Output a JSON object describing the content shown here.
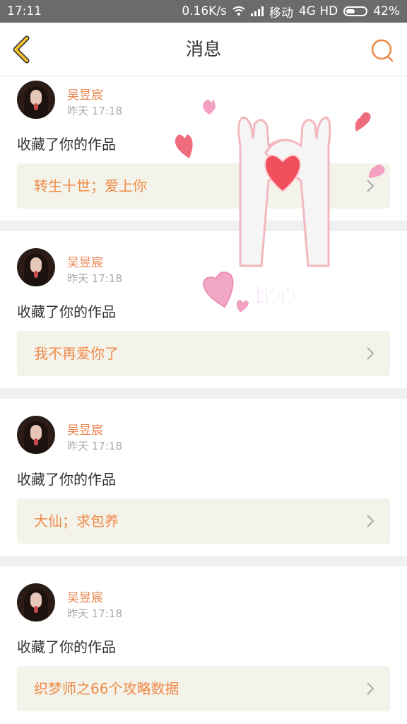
{
  "status_bar": {
    "time": "17:11",
    "speed": "0.16K/s",
    "carrier": "移动",
    "network": "4G HD",
    "battery": "42%"
  },
  "header": {
    "title": "消息",
    "back_icon": "chevron-left-icon",
    "search_icon": "search-icon"
  },
  "messages": [
    {
      "user": "吴昱宸",
      "time": "昨天 17:18",
      "action": "收藏了你的作品",
      "work": "转生十世；爱上你"
    },
    {
      "user": "吴昱宸",
      "time": "昨天 17:18",
      "action": "收藏了你的作品",
      "work": "我不再爱你了"
    },
    {
      "user": "吴昱宸",
      "time": "昨天 17:18",
      "action": "收藏了你的作品",
      "work": "大仙；求包养"
    },
    {
      "user": "吴昱宸",
      "time": "昨天 17:18",
      "action": "收藏了你的作品",
      "work": "织梦师之66个攻略数据"
    }
  ],
  "sticker": {
    "text": "比心"
  },
  "colors": {
    "accent": "#ef8a49",
    "username": "#e8844f",
    "work_bg": "#f4f3ea",
    "back_icon": "#f2c230"
  }
}
